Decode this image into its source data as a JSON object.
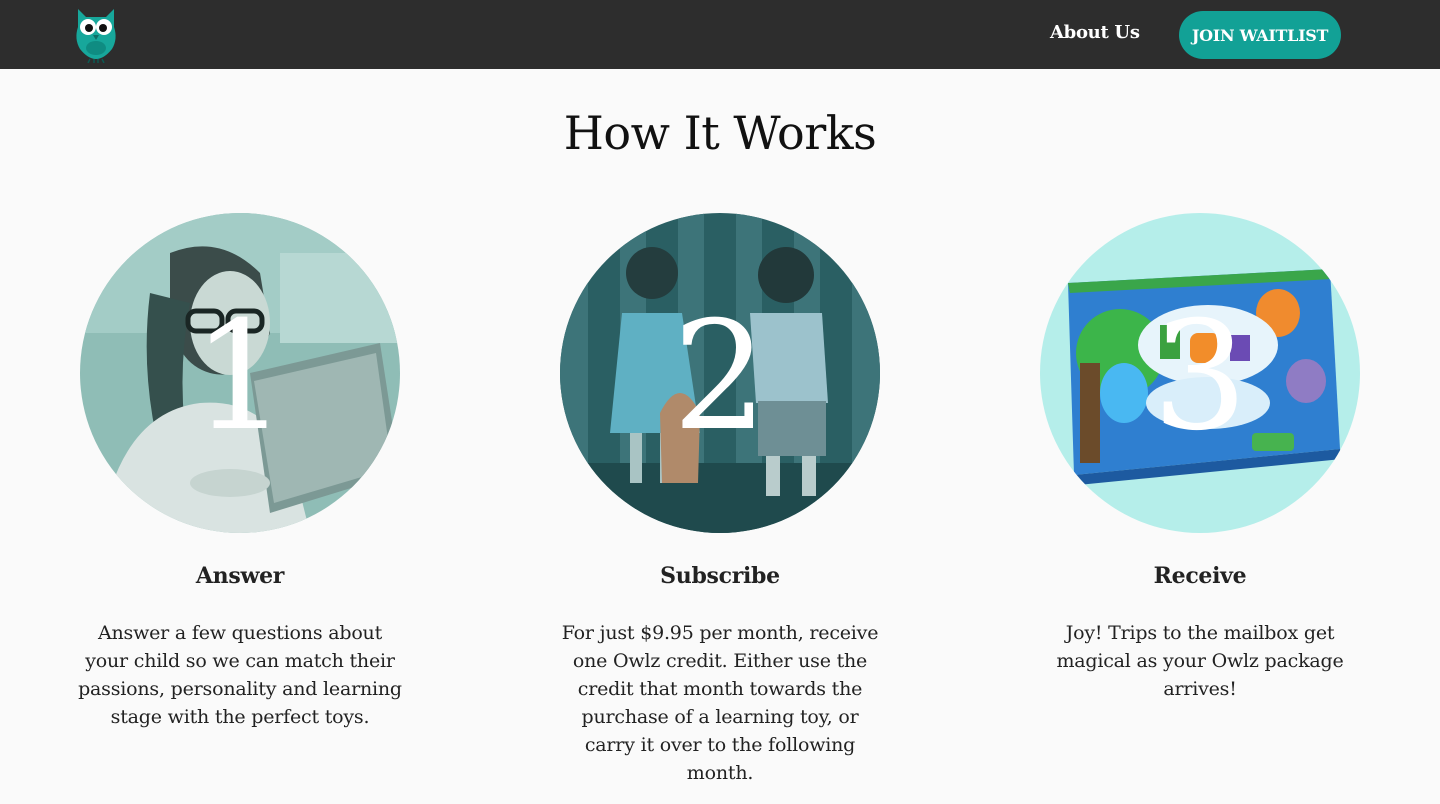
{
  "nav": {
    "about_label": "About Us",
    "join_label": "JOIN WAITLIST"
  },
  "page": {
    "title": "How It Works"
  },
  "steps": [
    {
      "number": "1",
      "title": "Answer",
      "text": "Answer a few questions about your child so we can match their passions, personality and learning stage with the perfect toys."
    },
    {
      "number": "2",
      "title": "Subscribe",
      "text": "For just $9.95 per month, receive one Owlz credit. Either use the credit that month towards the purchase of a learning toy, or carry it over to the following month."
    },
    {
      "number": "3",
      "title": "Receive",
      "text": "Joy! Trips to the mailbox get magical as your Owlz package arrives!"
    }
  ],
  "colors": {
    "nav_bg": "#2d2d2d",
    "accent": "#12a196",
    "overlay": "#3aa8a0"
  },
  "icons": {
    "logo": "owl-logo-icon"
  }
}
